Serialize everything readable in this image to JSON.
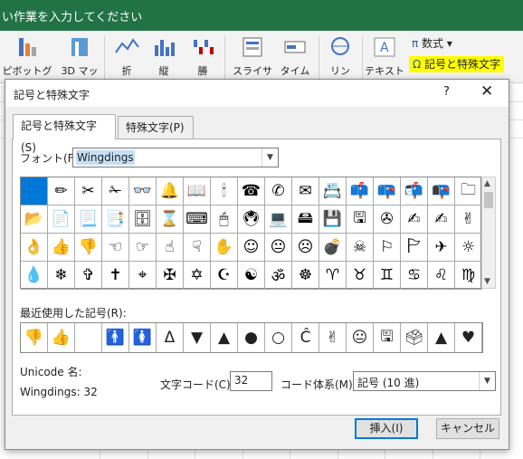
{
  "ribbon": {
    "instruction": "い作業を入力してください",
    "buttons": [
      "ピボットグラフ",
      "3D マッ",
      "折",
      "縦",
      "勝",
      "スライサー",
      "タイム",
      "リン",
      "テキスト"
    ],
    "formula_label": "数式",
    "special_label": "記号と特殊文字"
  },
  "dialog": {
    "title": "記号と特殊文字",
    "help": "?",
    "close": "✕",
    "tabs": [
      "記号と特殊文字(S)",
      "特殊文字(P)"
    ],
    "font_label": "フォント(F):",
    "font_value": "Wingdings",
    "symbols": [
      "",
      "✏",
      "✂",
      "✁",
      "👓",
      "🔔",
      "📖",
      "🕯",
      "☎",
      "✆",
      "✉",
      "📇",
      "📫",
      "📪",
      "📬",
      "📭",
      "🗀",
      "📂",
      "📄",
      "📃",
      "📑",
      "🗄",
      "⌛",
      "⌨",
      "🖱",
      "🖲",
      "💻",
      "🖴",
      "💾",
      "🖫",
      "✇",
      "✍",
      "✍",
      "✌",
      "👌",
      "👍",
      "👎",
      "☜",
      "☞",
      "☝",
      "☟",
      "✋",
      "☺",
      "😐",
      "☹",
      "💣",
      "☠",
      "⚐",
      "🏱",
      "✈",
      "☼",
      "💧",
      "❄",
      "✞",
      "✝",
      "⌖",
      "✠",
      "✡",
      "☪",
      "☯",
      "ॐ",
      "☸",
      "♈",
      "♉",
      "♊",
      "♋",
      "♌",
      "♍"
    ],
    "recent_label": "最近使用した記号(R):",
    "recent": [
      "👎",
      "👍",
      "",
      "🚹",
      "🚺",
      "Δ",
      "▼",
      "▲",
      "●",
      "○",
      "Ĉ",
      "✌",
      "😐",
      "🖫",
      "🗳",
      "▲",
      "♥"
    ],
    "unicode_label": "Unicode 名:",
    "unicode_value": "Wingdings: 32",
    "code_label": "文字コード(C):",
    "code_value": "32",
    "system_label": "コード体系(M):",
    "system_value": "記号 (10 進)",
    "insert_label": "挿入(I)",
    "cancel_label": "キャンセル"
  }
}
